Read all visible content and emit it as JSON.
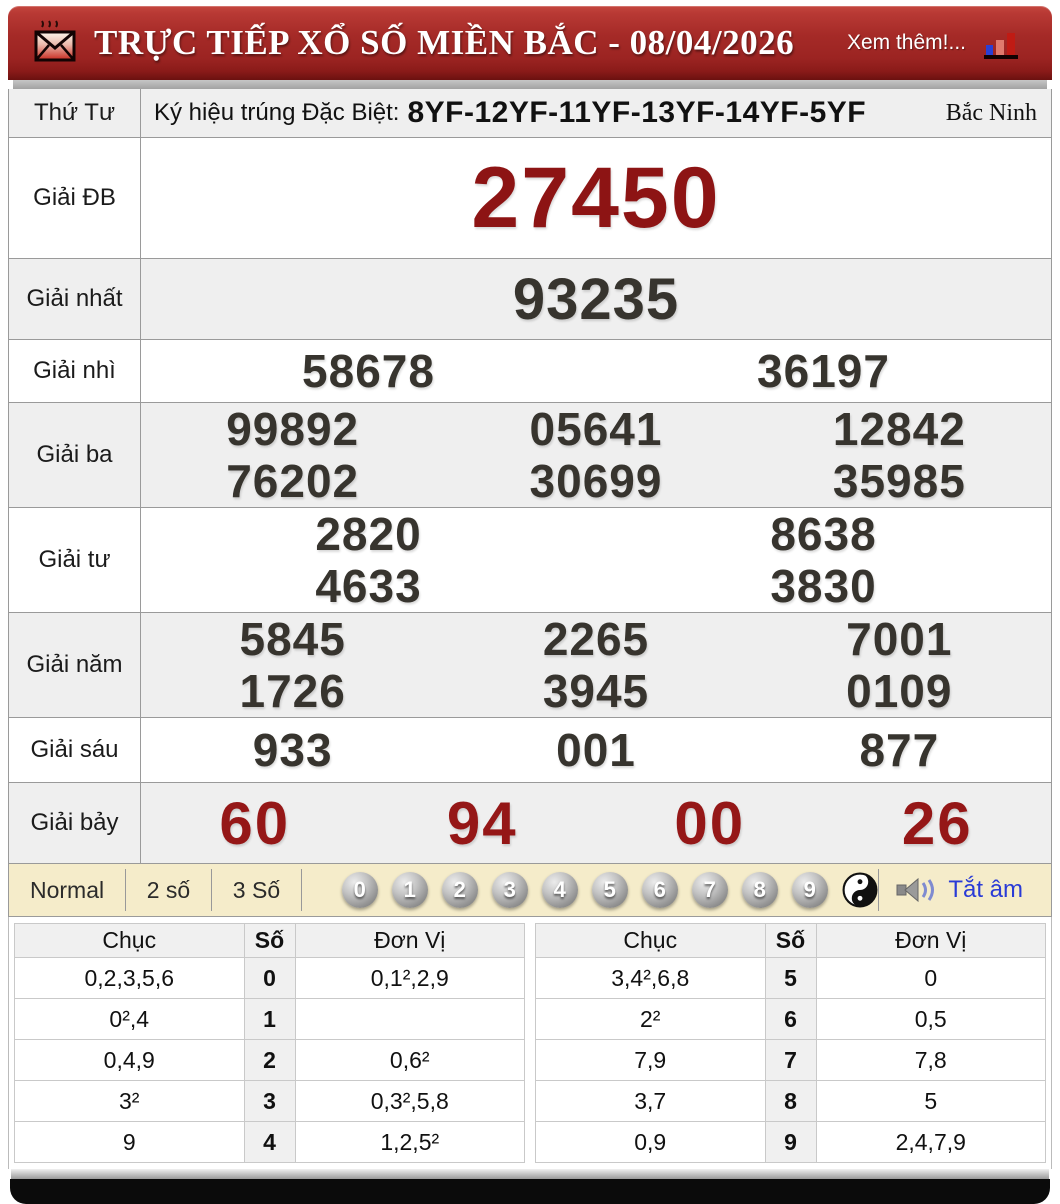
{
  "header": {
    "title": "TRỰC TIẾP XỔ SỐ MIỀN BẮC - 08/04/2026",
    "more_label": "Xem thêm!...",
    "icons": [
      "envelope-icon",
      "bar-chart-icon"
    ]
  },
  "info_row": {
    "weekday": "Thứ Tư",
    "sign_label": "Ký hiệu trúng Đặc Biệt:",
    "sign_codes": "8YF-12YF-11YF-13YF-14YF-5YF",
    "province": "Bắc Ninh"
  },
  "prizes": [
    {
      "label": "Giải ĐB",
      "rows": [
        [
          "27450"
        ]
      ]
    },
    {
      "label": "Giải nhất",
      "rows": [
        [
          "93235"
        ]
      ]
    },
    {
      "label": "Giải nhì",
      "rows": [
        [
          "58678",
          "36197"
        ]
      ]
    },
    {
      "label": "Giải ba",
      "rows": [
        [
          "99892",
          "05641",
          "12842"
        ],
        [
          "76202",
          "30699",
          "35985"
        ]
      ]
    },
    {
      "label": "Giải tư",
      "rows": [
        [
          "2820",
          "8638"
        ],
        [
          "4633",
          "3830"
        ]
      ]
    },
    {
      "label": "Giải năm",
      "rows": [
        [
          "5845",
          "2265",
          "7001"
        ],
        [
          "1726",
          "3945",
          "0109"
        ]
      ]
    },
    {
      "label": "Giải sáu",
      "rows": [
        [
          "933",
          "001",
          "877"
        ]
      ]
    },
    {
      "label": "Giải bảy",
      "rows": [
        [
          "60",
          "94",
          "00",
          "26"
        ]
      ]
    }
  ],
  "controls": {
    "modes": [
      "Normal",
      "2 số",
      "3 Số"
    ],
    "balls": [
      "0",
      "1",
      "2",
      "3",
      "4",
      "5",
      "6",
      "7",
      "8",
      "9"
    ],
    "extra_icons": [
      "yin-yang-icon",
      "speaker-icon"
    ],
    "mute_label": "Tắt âm"
  },
  "stats": {
    "headers": [
      "Chục",
      "Số",
      "Đơn Vị"
    ],
    "left": [
      {
        "tens": "0,2,3,5,6",
        "digit": "0",
        "units": "0,1²,2,9"
      },
      {
        "tens": "0²,4",
        "digit": "1",
        "units": ""
      },
      {
        "tens": "0,4,9",
        "digit": "2",
        "units": "0,6²"
      },
      {
        "tens": "3²",
        "digit": "3",
        "units": "0,3²,5,8"
      },
      {
        "tens": "9",
        "digit": "4",
        "units": "1,2,5²"
      }
    ],
    "right": [
      {
        "tens": "3,4²,6,8",
        "digit": "5",
        "units": "0"
      },
      {
        "tens": "2²",
        "digit": "6",
        "units": "0,5"
      },
      {
        "tens": "7,9",
        "digit": "7",
        "units": "7,8"
      },
      {
        "tens": "3,7",
        "digit": "8",
        "units": "5"
      },
      {
        "tens": "0,9",
        "digit": "9",
        "units": "2,4,7,9"
      }
    ]
  },
  "colors": {
    "banner_red": "#a52a27",
    "prize_maroon": "#8d1414",
    "control_bg": "#f5ecca",
    "link_blue": "#2a3bd6"
  }
}
